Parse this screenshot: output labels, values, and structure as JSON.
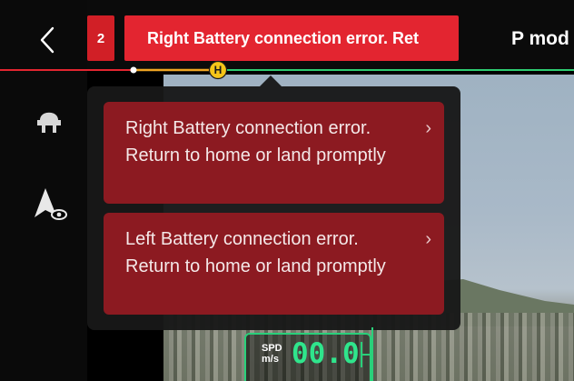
{
  "header": {
    "error_count": "2",
    "error_banner": "Right Battery connection error. Ret",
    "mode": "P mod"
  },
  "route": {
    "home_marker": "H"
  },
  "alerts": [
    {
      "text": "Right Battery connection error. Return to home or land promptly"
    },
    {
      "text": "Left Battery connection error. Return to home or land promptly"
    }
  ],
  "speed": {
    "label_top": "SPD",
    "label_bottom": "m/s",
    "value": "00.0"
  },
  "icons": {
    "back": "chevron-left-icon",
    "landing": "landing-gear-icon",
    "vision": "aircraft-vision-icon"
  },
  "colors": {
    "alert_red": "#e32530",
    "card_red": "#8c1a21",
    "route_green": "#2ecc71",
    "route_orange": "#f0a523",
    "speed_green": "#2fe58c"
  }
}
